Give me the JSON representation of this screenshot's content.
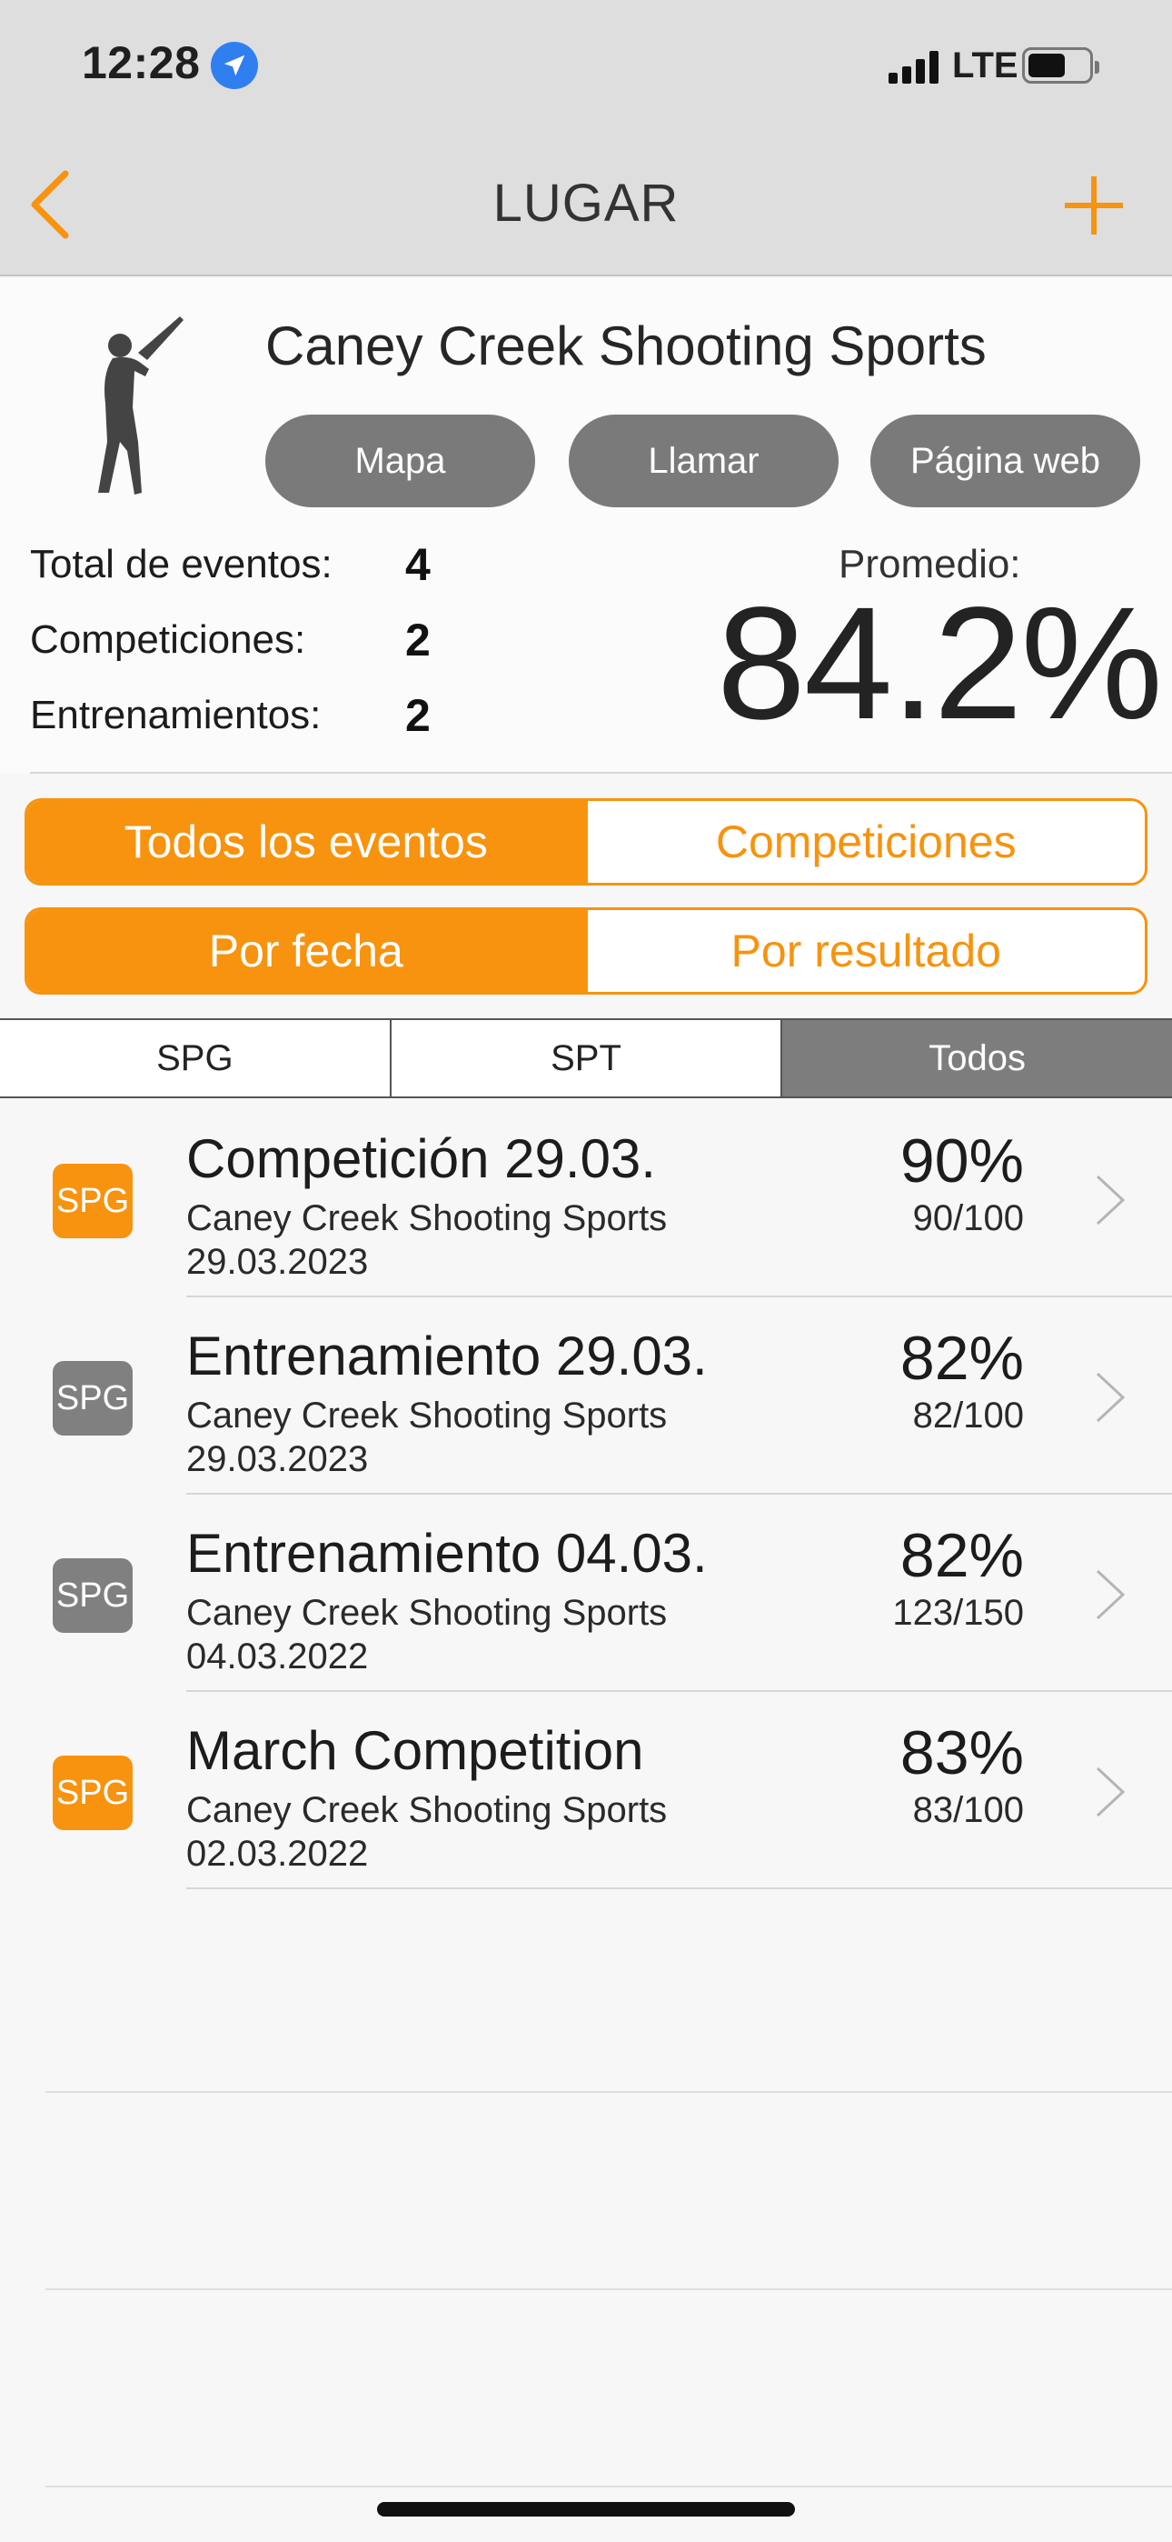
{
  "status_bar": {
    "time": "12:28",
    "network": "LTE"
  },
  "nav": {
    "title": "LUGAR"
  },
  "venue": {
    "name": "Caney Creek Shooting Sports",
    "buttons": {
      "map": "Mapa",
      "call": "Llamar",
      "website": "Página web"
    },
    "stats": {
      "total_label": "Total de eventos:",
      "total_value": "4",
      "competitions_label": "Competiciones:",
      "competitions_value": "2",
      "trainings_label": "Entrenamientos:",
      "trainings_value": "2"
    },
    "average_label": "Promedio:",
    "average_value": "84.2%"
  },
  "filter_segment": {
    "all": "Todos los eventos",
    "competitions": "Competiciones",
    "selected": "all"
  },
  "sort_segment": {
    "by_date": "Por fecha",
    "by_result": "Por resultado",
    "selected": "by_date"
  },
  "tabs": {
    "spg": "SPG",
    "spt": "SPT",
    "all": "Todos",
    "selected": "all"
  },
  "events": [
    {
      "badge": "SPG",
      "badge_color": "#f7930e",
      "title": "Competición 29.03.",
      "venue": "Caney Creek Shooting Sports",
      "date": "29.03.2023",
      "percent": "90%",
      "score": "90/100"
    },
    {
      "badge": "SPG",
      "badge_color": "#808080",
      "title": "Entrenamiento 29.03.",
      "venue": "Caney Creek Shooting Sports",
      "date": "29.03.2023",
      "percent": "82%",
      "score": "82/100"
    },
    {
      "badge": "SPG",
      "badge_color": "#808080",
      "title": "Entrenamiento 04.03.",
      "venue": "Caney Creek Shooting Sports",
      "date": "04.03.2022",
      "percent": "82%",
      "score": "123/150"
    },
    {
      "badge": "SPG",
      "badge_color": "#f7930e",
      "title": "March Competition",
      "venue": "Caney Creek Shooting Sports",
      "date": "02.03.2022",
      "percent": "83%",
      "score": "83/100"
    }
  ],
  "colors": {
    "accent": "#f7930e",
    "inactive_badge": "#808080",
    "nav_bar": "#dedede"
  },
  "icons": [
    "location-arrow-icon",
    "signal-icon",
    "battery-icon",
    "back-chevron-icon",
    "add-icon",
    "shooter-silhouette-icon",
    "chevron-right-icon"
  ]
}
